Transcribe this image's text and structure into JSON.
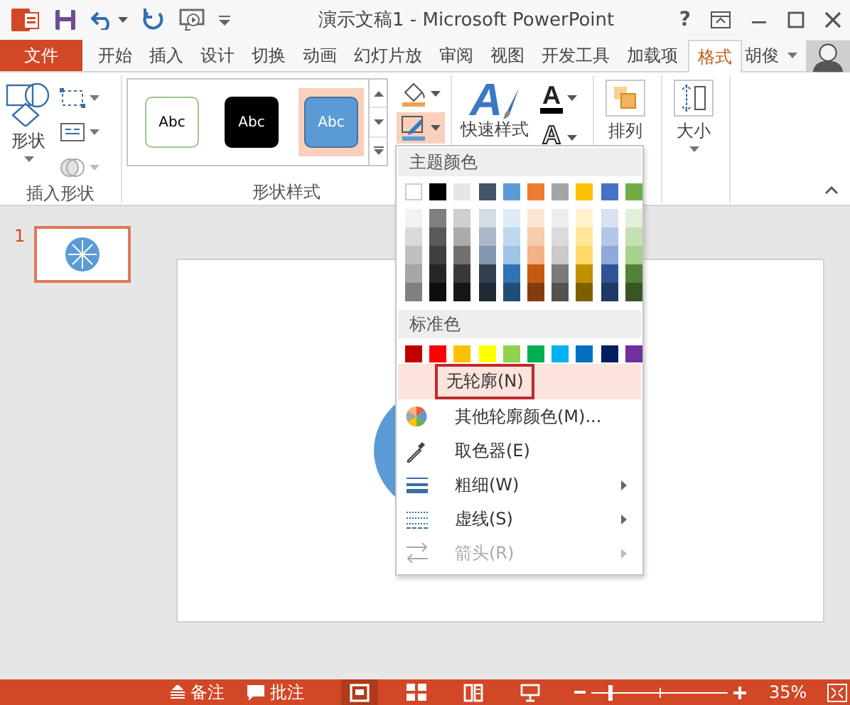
{
  "window": {
    "title": "演示文稿1 - Microsoft PowerPoint",
    "help": "?"
  },
  "tabs": [
    {
      "label": "文件",
      "kind": "file",
      "selected": false
    },
    {
      "label": "开始",
      "kind": "tab",
      "selected": false
    },
    {
      "label": "插入",
      "kind": "tab",
      "selected": false
    },
    {
      "label": "设计",
      "kind": "tab",
      "selected": false
    },
    {
      "label": "切换",
      "kind": "tab",
      "selected": false
    },
    {
      "label": "动画",
      "kind": "tab",
      "selected": false
    },
    {
      "label": "幻灯片放",
      "kind": "tab",
      "selected": false
    },
    {
      "label": "审阅",
      "kind": "tab",
      "selected": false
    },
    {
      "label": "视图",
      "kind": "tab",
      "selected": false
    },
    {
      "label": "开发工具",
      "kind": "tab",
      "selected": false
    },
    {
      "label": "加载项",
      "kind": "tab",
      "selected": false
    },
    {
      "label": "格式",
      "kind": "tab",
      "selected": true
    }
  ],
  "user": {
    "name": "胡俊"
  },
  "ribbon": {
    "insert_shapes": {
      "label": "插入形状",
      "shapes_button": "形状"
    },
    "shape_styles": {
      "label": "形状样式",
      "gallery": [
        {
          "label": "Abc",
          "kind": "outline",
          "selected": false
        },
        {
          "label": "Abc",
          "kind": "dark",
          "selected": false
        },
        {
          "label": "Abc",
          "kind": "blue",
          "selected": true
        }
      ],
      "outline_button": {
        "pressed": true
      }
    },
    "wordart": {
      "quick_styles_icon": "A",
      "quick_styles": "快速样式",
      "text_fill": "A",
      "text_outline": "A"
    },
    "arrange": {
      "label": "排列"
    },
    "size": {
      "label": "大小"
    }
  },
  "slides": [
    {
      "number": "1",
      "selected": true
    }
  ],
  "outline_menu": {
    "theme_header": "主题颜色",
    "theme_colors": [
      {
        "color": "#ffffff",
        "shades": [
          {
            "color": "#f2f2f2"
          },
          {
            "color": "#d9d9d9"
          },
          {
            "color": "#bfbfbf"
          },
          {
            "color": "#a6a6a6"
          },
          {
            "color": "#808080"
          }
        ]
      },
      {
        "color": "#000000",
        "shades": [
          {
            "color": "#7f7f7f"
          },
          {
            "color": "#595959"
          },
          {
            "color": "#404040"
          },
          {
            "color": "#262626"
          },
          {
            "color": "#0d0d0d"
          }
        ]
      },
      {
        "color": "#e7e6e6",
        "shades": [
          {
            "color": "#d0cece"
          },
          {
            "color": "#aeaaaa"
          },
          {
            "color": "#757070"
          },
          {
            "color": "#3a3838"
          },
          {
            "color": "#161616"
          }
        ]
      },
      {
        "color": "#44546a",
        "shades": [
          {
            "color": "#d6dce4"
          },
          {
            "color": "#adb9ca"
          },
          {
            "color": "#8496b0"
          },
          {
            "color": "#333f4f"
          },
          {
            "color": "#222a35"
          }
        ]
      },
      {
        "color": "#5b9bd5",
        "shades": [
          {
            "color": "#deebf6"
          },
          {
            "color": "#bdd7ee"
          },
          {
            "color": "#9dc3e6"
          },
          {
            "color": "#2e75b5"
          },
          {
            "color": "#1f4e79"
          }
        ]
      },
      {
        "color": "#ed7d31",
        "shades": [
          {
            "color": "#fbe5d5"
          },
          {
            "color": "#f7cbac"
          },
          {
            "color": "#f4b183"
          },
          {
            "color": "#c55a11"
          },
          {
            "color": "#833c0b"
          }
        ]
      },
      {
        "color": "#a5a5a5",
        "shades": [
          {
            "color": "#ededed"
          },
          {
            "color": "#dbdbdb"
          },
          {
            "color": "#c9c9c9"
          },
          {
            "color": "#7b7b7b"
          },
          {
            "color": "#525252"
          }
        ]
      },
      {
        "color": "#ffc000",
        "shades": [
          {
            "color": "#fff2cc"
          },
          {
            "color": "#fee599"
          },
          {
            "color": "#ffd965"
          },
          {
            "color": "#bf9000"
          },
          {
            "color": "#7f6000"
          }
        ]
      },
      {
        "color": "#4472c4",
        "shades": [
          {
            "color": "#d9e2f3"
          },
          {
            "color": "#b4c6e7"
          },
          {
            "color": "#8eaadb"
          },
          {
            "color": "#2f5496"
          },
          {
            "color": "#1f3864"
          }
        ]
      },
      {
        "color": "#70ad47",
        "shades": [
          {
            "color": "#e2efd9"
          },
          {
            "color": "#c5e0b3"
          },
          {
            "color": "#a8d08d"
          },
          {
            "color": "#538135"
          },
          {
            "color": "#375623"
          }
        ]
      }
    ],
    "standard_header": "标准色",
    "standard_colors": [
      {
        "color": "#c00000"
      },
      {
        "color": "#ff0000"
      },
      {
        "color": "#ffc000"
      },
      {
        "color": "#ffff00"
      },
      {
        "color": "#92d050"
      },
      {
        "color": "#00b050"
      },
      {
        "color": "#00b0f0"
      },
      {
        "color": "#0070c0"
      },
      {
        "color": "#002060"
      },
      {
        "color": "#7030a0"
      }
    ],
    "items": [
      {
        "label": "无轮廓(N)",
        "kind": "none",
        "selected": true,
        "highlighted": true,
        "submenu": false,
        "disabled": false
      },
      {
        "label": "其他轮廓颜色(M)...",
        "kind": "more",
        "selected": false,
        "highlighted": false,
        "submenu": false,
        "disabled": false
      },
      {
        "label": "取色器(E)",
        "kind": "eyedropper",
        "selected": false,
        "highlighted": false,
        "submenu": false,
        "disabled": false
      },
      {
        "label": "粗细(W)",
        "kind": "weight",
        "selected": false,
        "highlighted": false,
        "submenu": true,
        "disabled": false
      },
      {
        "label": "虚线(S)",
        "kind": "dash",
        "selected": false,
        "highlighted": false,
        "submenu": true,
        "disabled": false
      },
      {
        "label": "箭头(R)",
        "kind": "arrow",
        "selected": false,
        "highlighted": false,
        "submenu": true,
        "disabled": true
      }
    ]
  },
  "status_bar": {
    "notes": "备注",
    "comments": "批注",
    "views": [
      {
        "kind": "normal",
        "selected": true
      },
      {
        "kind": "sorter",
        "selected": false
      },
      {
        "kind": "reading",
        "selected": false
      },
      {
        "kind": "show",
        "selected": false
      }
    ],
    "zoom": {
      "level": 0.13,
      "reading": "35%"
    }
  }
}
